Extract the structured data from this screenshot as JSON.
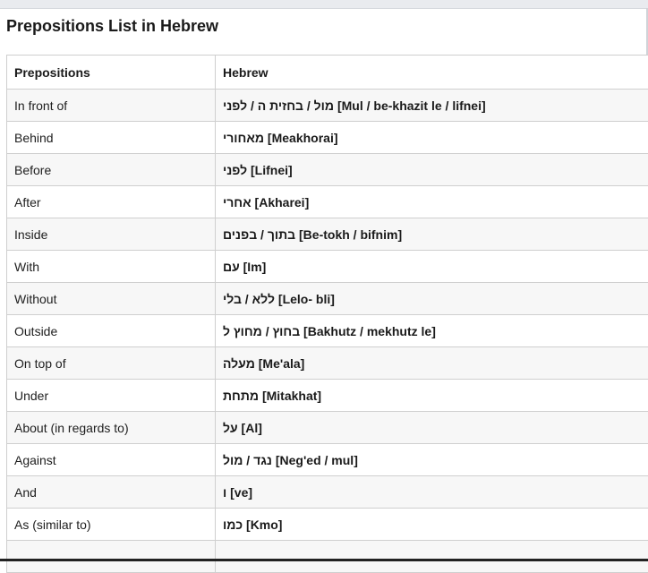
{
  "page": {
    "heading": "Prepositions List in Hebrew"
  },
  "table": {
    "headers": [
      "Prepositions",
      "Hebrew"
    ],
    "rows": [
      {
        "english": "In front of",
        "hebrew": "מול / בחזית ה / לפני [Mul / be-khazit le / lifnei]"
      },
      {
        "english": "Behind",
        "hebrew": "מאחורי [Meakhorai]"
      },
      {
        "english": "Before",
        "hebrew": "לפני [Lifnei]"
      },
      {
        "english": "After",
        "hebrew": "אחרי [Akharei]"
      },
      {
        "english": "Inside",
        "hebrew": "בתוך / בפנים [Be-tokh / bifnim]"
      },
      {
        "english": "With",
        "hebrew": "עם [Im]"
      },
      {
        "english": "Without",
        "hebrew": "ללא / בלי [Lelo- bli]"
      },
      {
        "english": "Outside",
        "hebrew": "בחוץ / מחוץ ל [Bakhutz / mekhutz le]"
      },
      {
        "english": "On top of",
        "hebrew": "מעלה [Me'ala]"
      },
      {
        "english": "Under",
        "hebrew": "מתחת [Mitakhat]"
      },
      {
        "english": "About (in regards to)",
        "hebrew": "על [Al]"
      },
      {
        "english": "Against",
        "hebrew": "נגד / מול [Neg'ed / mul]"
      },
      {
        "english": "And",
        "hebrew": "ו [ve]"
      },
      {
        "english": "As (similar to)",
        "hebrew": "כמו [Kmo]"
      },
      {
        "english": "",
        "hebrew": ""
      }
    ]
  }
}
